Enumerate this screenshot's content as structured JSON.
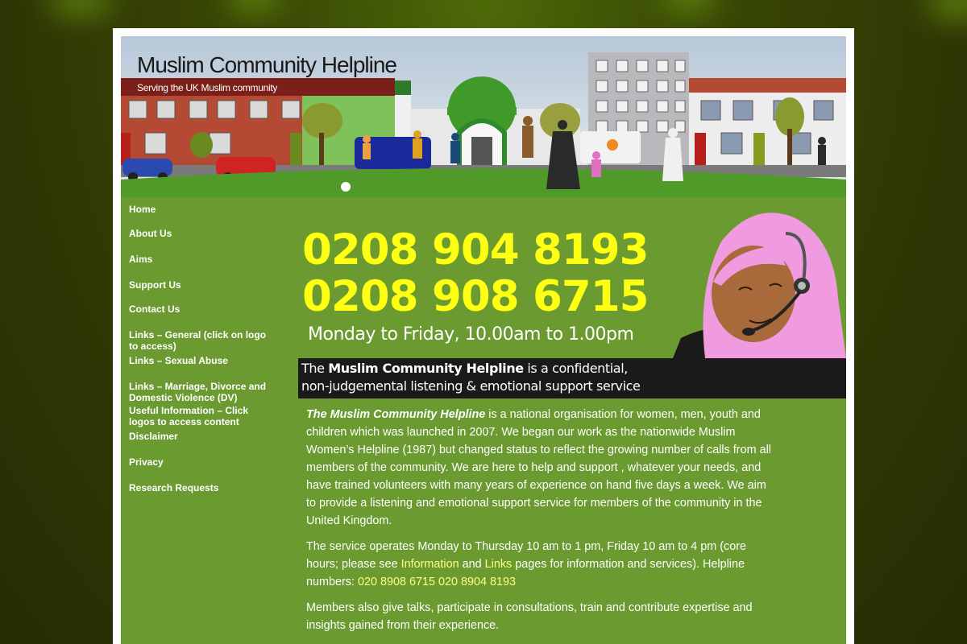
{
  "site": {
    "title": "Muslim Community Helpline",
    "tagline": "Serving the UK Muslim community"
  },
  "nav": [
    {
      "label": "Home",
      "name": "nav-home"
    },
    {
      "label": "About Us",
      "name": "nav-about-us"
    },
    {
      "label": "Aims",
      "name": "nav-aims"
    },
    {
      "label": "Support Us",
      "name": "nav-support-us"
    },
    {
      "label": "Contact Us",
      "name": "nav-contact-us"
    },
    {
      "label": "Links – General (click on logo to access)",
      "name": "nav-links-general"
    },
    {
      "label": "Links – Sexual Abuse",
      "name": "nav-links-sexual-abuse"
    },
    {
      "label": "Links – Marriage, Divorce and Domestic Violence (DV)",
      "name": "nav-links-marriage"
    },
    {
      "label": "Useful Information – Click logos to access content",
      "name": "nav-useful-information"
    },
    {
      "label": "Disclaimer",
      "name": "nav-disclaimer"
    },
    {
      "label": "Privacy",
      "name": "nav-privacy"
    },
    {
      "label": "Research Requests",
      "name": "nav-research-requests"
    }
  ],
  "hero": {
    "phone1": "0208 904 8193",
    "phone2": "0208 908 6715",
    "hours": "Monday to Friday, 10.00am to 1.00pm",
    "tag_prefix": "The ",
    "tag_bold": "Muslim Community Helpline",
    "tag_line1_rest": " is a confidential,",
    "tag_line2": "non-judgemental listening & emotional support service"
  },
  "content": {
    "p1_lead": "The Muslim Community Helpline",
    "p1_rest": " is a national organisation for women, men, youth and children which was launched in 2007. We began our work as the nationwide Muslim Women’s Helpline (1987) but changed status to reflect the growing number of calls from all members of the community. We are here to help and support , whatever your needs, and have trained volunteers with many years of experience on hand five days a week. We aim to provide a listening and emotional support service for members of the community in the United Kingdom.",
    "p2_a": "The service operates Monday to Thursday 10 am to 1 pm, Friday 10 am to 4 pm (core hours; please see ",
    "p2_link1": "Information",
    "p2_b": " and ",
    "p2_link2": "Links",
    "p2_c": " pages for information and services).  Helpline numbers: ",
    "p2_phone_link": "020 8908 6715 020 8904 8193",
    "p3": "Members also give talks, participate in consultations, train and contribute expertise and insights gained from their experience."
  },
  "colors": {
    "background": "#2e3504",
    "content_green": "#6a9a30",
    "phone_yellow": "#ffff14",
    "link_yellow": "#ffff80",
    "tag_box": "#1a1a1a"
  }
}
